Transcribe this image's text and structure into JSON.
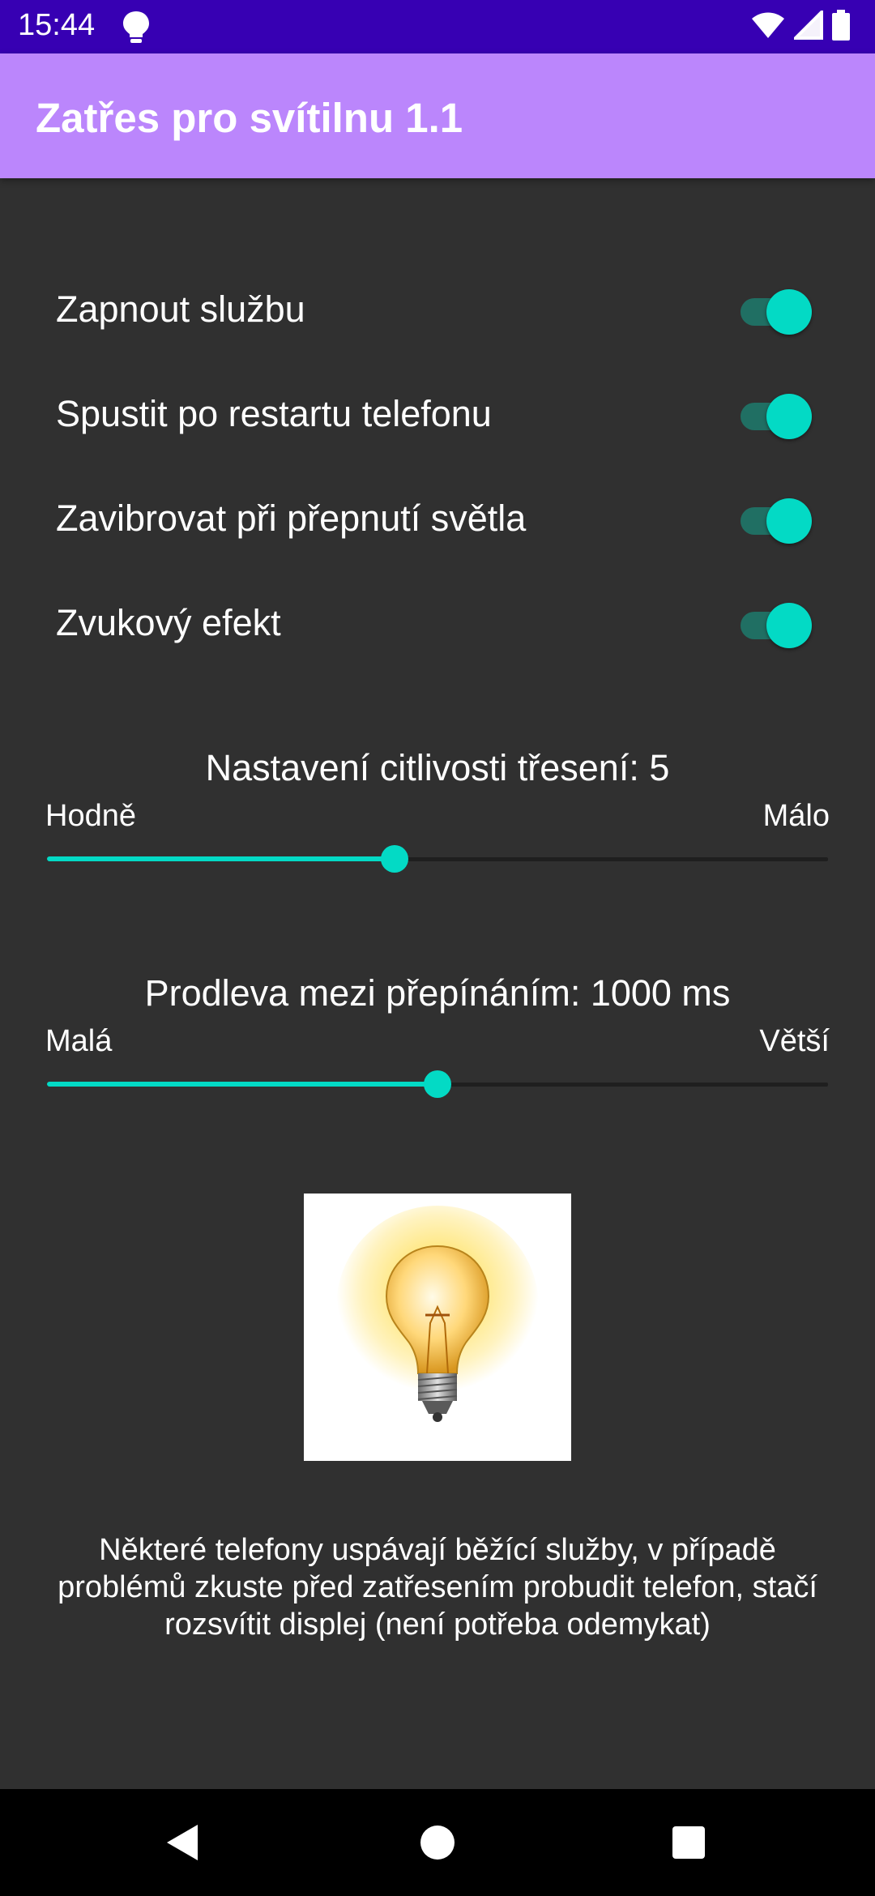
{
  "status_bar": {
    "time": "15:44",
    "icons": [
      "lightbulb-icon",
      "wifi-icon",
      "signal-icon",
      "battery-icon"
    ]
  },
  "app_bar": {
    "title": "Zatřes pro svítilnu 1.1",
    "color": "#bb86fc"
  },
  "switches": [
    {
      "label": "Zapnout službu",
      "checked": true
    },
    {
      "label": "Spustit po restartu telefonu",
      "checked": true
    },
    {
      "label": "Zavibrovat při přepnutí světla",
      "checked": true
    },
    {
      "label": "Zvukový efekt",
      "checked": true
    }
  ],
  "sensitivity": {
    "title": "Nastavení citlivosti třesení: 5",
    "min_label": "Hodně",
    "max_label": "Málo",
    "fraction": 0.445
  },
  "delay": {
    "title": "Prodleva mezi přepínáním: 1000 ms",
    "min_label": "Malá",
    "max_label": "Větší",
    "fraction": 0.5
  },
  "image": {
    "icon": "lightbulb-image"
  },
  "info_text": "Některé telefony uspávají běžící služby, v případě problémů zkuste před zatřesením probudit telefon, stačí rozsvítit displej (není potřeba odemykat)",
  "colors": {
    "accent": "#03dac5",
    "background": "#303030",
    "status_bar": "#3700b3"
  },
  "nav_bar": {
    "buttons": [
      "back-icon",
      "home-icon",
      "recents-icon"
    ]
  }
}
